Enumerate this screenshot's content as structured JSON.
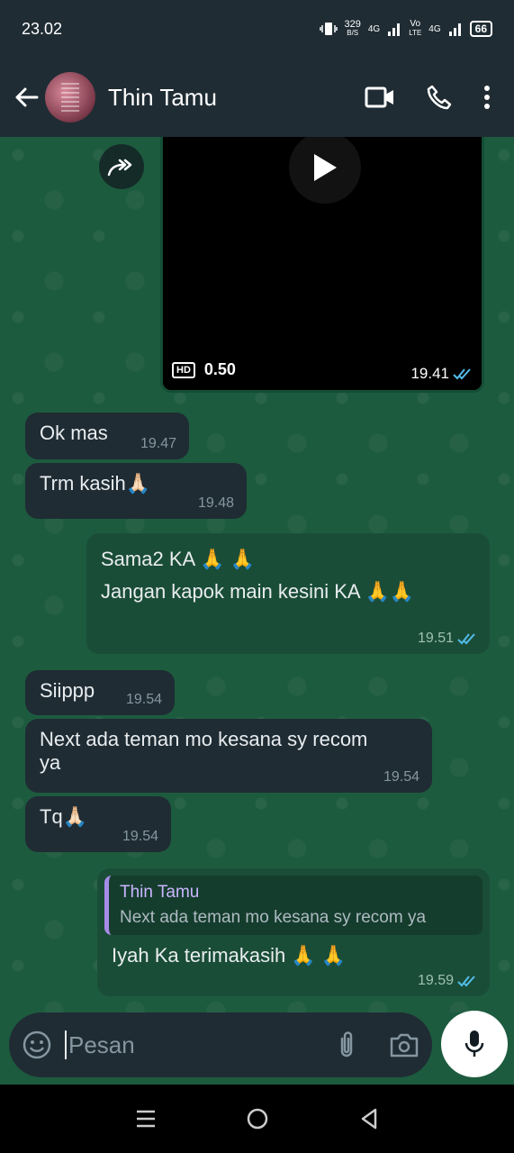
{
  "status_bar": {
    "time": "23.02",
    "net_speed_value": "329",
    "net_speed_unit": "B/S",
    "net1": "4G",
    "volte_top": "Vo",
    "volte_bottom": "LTE",
    "net2": "4G",
    "battery": "66"
  },
  "header": {
    "contact_name": "Thin Tamu"
  },
  "video_message": {
    "hd_label": "HD",
    "duration": "0.50",
    "time": "19.41"
  },
  "messages": [
    {
      "text": "Ok mas",
      "time": "19.47"
    },
    {
      "text": "Trm kasih🙏🏻",
      "time": "19.48"
    },
    {
      "line1": "Sama2 KA 🙏 🙏",
      "line2": "Jangan kapok main kesini KA 🙏🙏",
      "time": "19.51"
    },
    {
      "text": "Siippp",
      "time": "19.54"
    },
    {
      "line1": "Next ada teman mo kesana sy recom",
      "line2": "ya",
      "time": "19.54"
    },
    {
      "text": "Tq🙏🏻",
      "time": "19.54"
    },
    {
      "quote_name": "Thin Tamu",
      "quote_text": "Next ada teman mo kesana sy recom ya",
      "text": "Iyah Ka terimakasih 🙏 🙏",
      "time": "19.59"
    }
  ],
  "composer": {
    "placeholder": "Pesan"
  },
  "colors": {
    "chat_bg": "#1d5b3e",
    "incoming_bubble": "#1f2c34",
    "outgoing_bubble": "#1a4d38",
    "read_ticks": "#53bdeb"
  }
}
